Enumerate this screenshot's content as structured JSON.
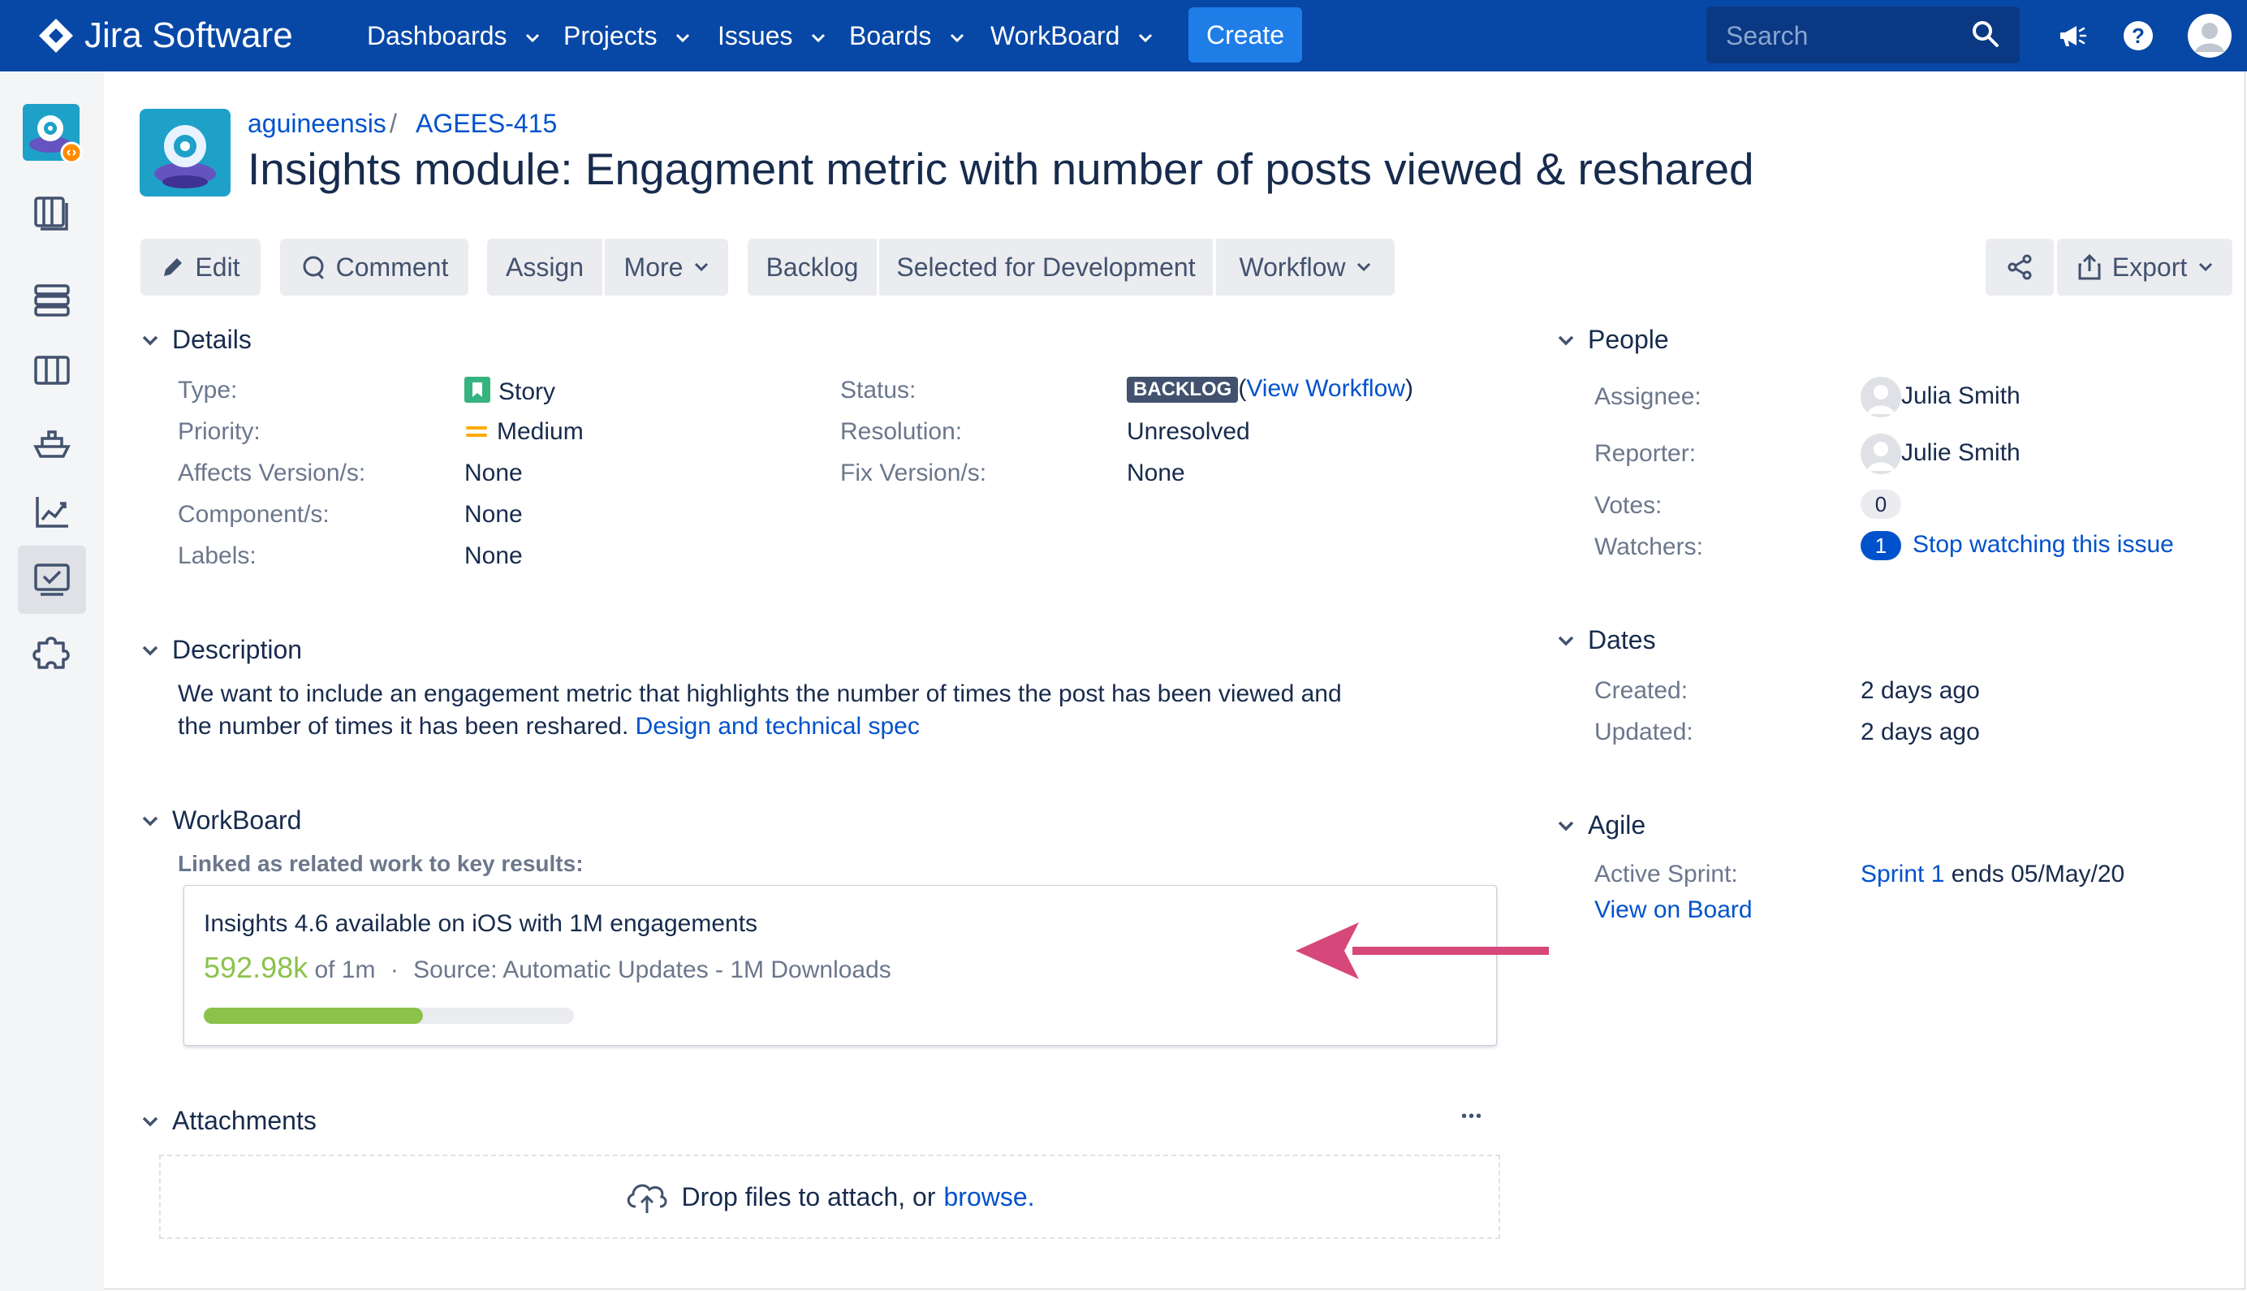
{
  "nav": {
    "product": "Jira Software",
    "items": [
      "Dashboards",
      "Projects",
      "Issues",
      "Boards",
      "WorkBoard"
    ],
    "create_label": "Create",
    "search_placeholder": "Search"
  },
  "breadcrumb": {
    "project": "aguineensis",
    "separator": "/",
    "issue_key": "AGEES-415"
  },
  "issue_title": "Insights module: Engagment metric with number of posts viewed & reshared",
  "toolbar": {
    "edit": "Edit",
    "comment": "Comment",
    "assign": "Assign",
    "more": "More",
    "backlog": "Backlog",
    "selected_for_development": "Selected for Development",
    "workflow": "Workflow",
    "export": "Export"
  },
  "details": {
    "heading": "Details",
    "type_label": "Type:",
    "type_value": "Story",
    "priority_label": "Priority:",
    "priority_value": "Medium",
    "affects_label": "Affects Version/s:",
    "affects_value": "None",
    "component_label": "Component/s:",
    "component_value": "None",
    "labels_label": "Labels:",
    "labels_value": "None",
    "status_label": "Status:",
    "status_value": "BACKLOG",
    "view_workflow": "View Workflow",
    "paren_open": "(",
    "paren_close": ")",
    "resolution_label": "Resolution:",
    "resolution_value": "Unresolved",
    "fix_label": "Fix Version/s:",
    "fix_value": "None"
  },
  "description": {
    "heading": "Description",
    "text_line1": "We want to include an engagement metric that highlights the number of times the post has been viewed and",
    "text_line2": "the number of times it has been reshared.",
    "link": "Design and technical spec"
  },
  "workboard": {
    "heading": "WorkBoard",
    "subheading": "Linked as related work to key results:",
    "kr_title": "Insights 4.6 available on iOS with 1M engagements",
    "kr_current": "592.98k",
    "kr_of": "of 1m",
    "kr_dot": "·",
    "kr_source": "Source: Automatic Updates - 1M Downloads",
    "kr_progress": 0.593
  },
  "attachments": {
    "heading": "Attachments",
    "more": "•••",
    "drop_text": "Drop files to attach, or",
    "browse": "browse."
  },
  "people": {
    "heading": "People",
    "assignee_label": "Assignee:",
    "assignee": "Julia Smith",
    "reporter_label": "Reporter:",
    "reporter": "Julie Smith",
    "votes_label": "Votes:",
    "votes": "0",
    "watchers_label": "Watchers:",
    "watchers": "1",
    "stop_watching": "Stop watching this issue"
  },
  "dates": {
    "heading": "Dates",
    "created_label": "Created:",
    "created": "2 days ago",
    "updated_label": "Updated:",
    "updated": "2 days ago"
  },
  "agile": {
    "heading": "Agile",
    "active_sprint_label": "Active Sprint:",
    "sprint": "Sprint 1",
    "sprint_ends": "ends 05/May/20",
    "view_on_board": "View on Board"
  },
  "colors": {
    "nav_bg": "#0747a6",
    "link": "#0052cc",
    "progress": "#8bc34a",
    "arrow": "#d6477a",
    "story_icon": "#36b37e",
    "priority_medium": "#ffab00"
  }
}
